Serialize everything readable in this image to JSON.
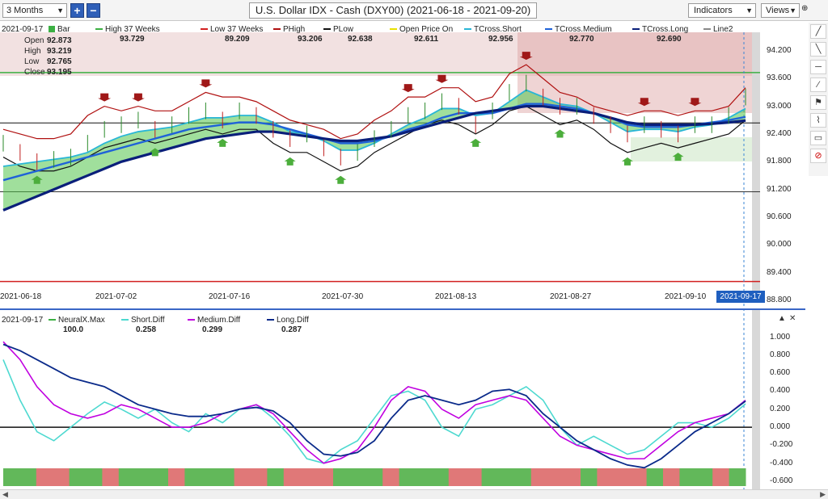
{
  "toolbar": {
    "range_label": "3 Months",
    "zoom_in": "+",
    "zoom_out": "−",
    "title": "U.S. Dollar IDX - Cash (DXY00) (2021-06-18 - 2021-09-20)",
    "indicators_label": "Indicators",
    "views_label": "Views",
    "pin": "⊕"
  },
  "side_tools": [
    "╱",
    "╲",
    "─",
    "⁄",
    "⚑",
    "⌇",
    "▭",
    "⊘"
  ],
  "side_tool_icons": [
    "trendline-icon",
    "ray-icon",
    "horizontal-line-icon",
    "angle-line-icon",
    "flag-icon",
    "fib-icon",
    "rectangle-icon",
    "delete-icon"
  ],
  "price_legend": {
    "date": "2021-09-17",
    "bar_label": "Bar",
    "ohlc": {
      "open_label": "Open",
      "open": "92.873",
      "high_label": "High",
      "high": "93.219",
      "low_label": "Low",
      "low": "92.765",
      "close_label": "Close",
      "close": "93.195"
    },
    "items": [
      {
        "label": "High 37 Weeks",
        "value": "93.729",
        "color": "#3cb043"
      },
      {
        "label": "Low 37 Weeks",
        "value": "89.209",
        "color": "#d22020"
      },
      {
        "label": "PHigh",
        "value": "93.206",
        "color": "#b01010"
      },
      {
        "label": "PLow",
        "value": "92.638",
        "color": "#111111"
      },
      {
        "label": "Open Price On",
        "value": "92.611",
        "color": "#e8e000"
      },
      {
        "label": "TCross.Short",
        "value": "92.956",
        "color": "#29b6d6"
      },
      {
        "label": "TCross.Medium",
        "value": "92.770",
        "color": "#1f62d8"
      },
      {
        "label": "TCross.Long",
        "value": "92.690",
        "color": "#0a1f7a"
      },
      {
        "label": "Line2",
        "value": "",
        "color": "#888888"
      }
    ]
  },
  "indicator_legend": {
    "date": "2021-09-17",
    "items": [
      {
        "label": "NeuralX.Max",
        "value": "100.0",
        "color": "#3cb043"
      },
      {
        "label": "Short.Diff",
        "value": "0.258",
        "color": "#4dd9d0"
      },
      {
        "label": "Medium.Diff",
        "value": "0.299",
        "color": "#c000e0"
      },
      {
        "label": "Long.Diff",
        "value": "0.287",
        "color": "#0a2a8a"
      }
    ]
  },
  "x_labels": [
    "2021-06-18",
    "2021-07-02",
    "2021-07-16",
    "2021-07-30",
    "2021-08-13",
    "2021-08-27",
    "2021-09-10",
    "2021-09-17"
  ],
  "price_ticks": [
    "94.200",
    "93.600",
    "93.000",
    "92.400",
    "91.800",
    "91.200",
    "90.600",
    "90.000",
    "89.400",
    "88.800"
  ],
  "ind_ticks": [
    "1.000",
    "0.800",
    "0.600",
    "0.400",
    "0.200",
    "0.000",
    "-0.200",
    "-0.400",
    "-0.600"
  ],
  "chart_data": [
    {
      "type": "line",
      "title": "U.S. Dollar IDX - Cash (DXY00) (2021-06-18 - 2021-09-20)",
      "ylim": [
        88.8,
        94.6
      ],
      "x_range": [
        "2021-06-18",
        "2021-09-17"
      ],
      "levels": {
        "high_37_weeks": 93.729,
        "low_37_weeks": 89.209,
        "plow_level": 92.638,
        "long_term_low": 91.15
      },
      "series": [
        {
          "name": "Bar",
          "values": [
            92.2,
            92.0,
            91.8,
            91.85,
            91.9,
            92.2,
            92.5,
            92.6,
            92.7,
            92.5,
            92.6,
            92.8,
            92.9,
            92.7,
            92.9,
            92.8,
            92.5,
            92.3,
            92.4,
            92.1,
            91.9,
            92.0,
            92.3,
            92.5,
            92.8,
            92.9,
            93.1,
            93.0,
            92.6,
            92.9,
            93.3,
            93.5,
            93.2,
            93.0,
            93.0,
            92.8,
            92.6,
            92.4,
            92.6,
            92.5,
            92.4,
            92.6,
            92.6,
            92.8,
            93.2
          ]
        },
        {
          "name": "PHigh",
          "values": [
            92.5,
            92.4,
            92.3,
            92.3,
            92.4,
            92.8,
            93.0,
            92.9,
            93.0,
            92.9,
            92.9,
            93.1,
            93.3,
            93.2,
            93.2,
            93.1,
            92.9,
            92.7,
            92.6,
            92.5,
            92.3,
            92.4,
            92.7,
            92.9,
            93.2,
            93.2,
            93.4,
            93.4,
            93.1,
            93.2,
            93.7,
            93.9,
            93.6,
            93.3,
            93.2,
            93.0,
            92.9,
            92.8,
            92.9,
            92.9,
            92.8,
            92.9,
            92.9,
            93.0,
            93.4
          ]
        },
        {
          "name": "PLow",
          "values": [
            91.9,
            91.7,
            91.6,
            91.6,
            91.7,
            91.9,
            92.1,
            92.2,
            92.3,
            92.2,
            92.3,
            92.4,
            92.5,
            92.4,
            92.5,
            92.5,
            92.2,
            92.0,
            92.0,
            91.8,
            91.6,
            91.7,
            92.0,
            92.2,
            92.4,
            92.6,
            92.7,
            92.6,
            92.4,
            92.6,
            92.9,
            93.0,
            92.8,
            92.6,
            92.7,
            92.5,
            92.2,
            92.0,
            92.1,
            92.2,
            92.1,
            92.2,
            92.3,
            92.4,
            92.7
          ]
        },
        {
          "name": "TCross.Short",
          "values": [
            91.7,
            91.75,
            91.8,
            91.85,
            91.9,
            92.0,
            92.2,
            92.35,
            92.45,
            92.5,
            92.55,
            92.65,
            92.75,
            92.75,
            92.8,
            92.8,
            92.65,
            92.45,
            92.4,
            92.25,
            92.05,
            92.05,
            92.2,
            92.4,
            92.6,
            92.75,
            92.95,
            92.95,
            92.8,
            92.85,
            93.1,
            93.35,
            93.2,
            93.05,
            93.0,
            92.85,
            92.65,
            92.45,
            92.5,
            92.5,
            92.45,
            92.55,
            92.6,
            92.75,
            92.95
          ]
        },
        {
          "name": "TCross.Medium",
          "values": [
            91.4,
            91.5,
            91.6,
            91.7,
            91.8,
            91.9,
            92.0,
            92.1,
            92.2,
            92.3,
            92.4,
            92.5,
            92.55,
            92.6,
            92.65,
            92.65,
            92.6,
            92.5,
            92.4,
            92.3,
            92.2,
            92.2,
            92.25,
            92.35,
            92.5,
            92.6,
            92.75,
            92.85,
            92.85,
            92.85,
            92.95,
            93.05,
            93.05,
            93.0,
            92.95,
            92.85,
            92.75,
            92.6,
            92.55,
            92.55,
            92.55,
            92.6,
            92.65,
            92.7,
            92.77
          ]
        },
        {
          "name": "TCross.Long",
          "values": [
            90.75,
            90.9,
            91.05,
            91.2,
            91.35,
            91.5,
            91.65,
            91.8,
            91.9,
            92.0,
            92.1,
            92.2,
            92.3,
            92.35,
            92.4,
            92.45,
            92.45,
            92.4,
            92.35,
            92.3,
            92.25,
            92.25,
            92.3,
            92.35,
            92.45,
            92.55,
            92.65,
            92.75,
            92.85,
            92.9,
            92.95,
            93.0,
            93.0,
            92.95,
            92.9,
            92.85,
            92.75,
            92.65,
            92.6,
            92.6,
            92.6,
            92.6,
            92.62,
            92.65,
            92.69
          ]
        }
      ]
    },
    {
      "type": "line",
      "title": "",
      "ylim": [
        -0.6,
        1.05
      ],
      "x_range": [
        "2021-06-18",
        "2021-09-17"
      ],
      "series": [
        {
          "name": "Short.Diff",
          "values": [
            0.75,
            0.3,
            -0.05,
            -0.15,
            0.0,
            0.15,
            0.28,
            0.2,
            0.1,
            0.2,
            0.05,
            -0.05,
            0.15,
            0.05,
            0.2,
            0.25,
            0.1,
            -0.1,
            -0.35,
            -0.4,
            -0.25,
            -0.15,
            0.1,
            0.35,
            0.4,
            0.3,
            0.0,
            -0.1,
            0.2,
            0.25,
            0.35,
            0.45,
            0.3,
            0.0,
            -0.2,
            -0.1,
            -0.2,
            -0.3,
            -0.25,
            -0.1,
            0.05,
            0.05,
            0.0,
            0.1,
            0.26
          ]
        },
        {
          "name": "Medium.Diff",
          "values": [
            0.95,
            0.75,
            0.45,
            0.25,
            0.15,
            0.1,
            0.15,
            0.25,
            0.2,
            0.1,
            0.0,
            0.0,
            0.05,
            0.15,
            0.2,
            0.25,
            0.15,
            -0.05,
            -0.25,
            -0.4,
            -0.35,
            -0.25,
            0.0,
            0.3,
            0.45,
            0.4,
            0.2,
            0.1,
            0.25,
            0.3,
            0.35,
            0.3,
            0.1,
            -0.1,
            -0.2,
            -0.25,
            -0.3,
            -0.35,
            -0.35,
            -0.2,
            -0.05,
            0.05,
            0.1,
            0.15,
            0.3
          ]
        },
        {
          "name": "Long.Diff",
          "values": [
            0.92,
            0.85,
            0.75,
            0.65,
            0.55,
            0.5,
            0.45,
            0.35,
            0.25,
            0.2,
            0.15,
            0.12,
            0.12,
            0.15,
            0.2,
            0.22,
            0.18,
            0.05,
            -0.15,
            -0.3,
            -0.32,
            -0.28,
            -0.15,
            0.1,
            0.3,
            0.35,
            0.3,
            0.25,
            0.3,
            0.4,
            0.42,
            0.35,
            0.15,
            0.0,
            -0.15,
            -0.25,
            -0.35,
            -0.42,
            -0.45,
            -0.35,
            -0.2,
            -0.05,
            0.05,
            0.15,
            0.29
          ]
        },
        {
          "name": "NeuralX.Max",
          "values": [
            1,
            1,
            0,
            0,
            1,
            1,
            0,
            1,
            1,
            1,
            0,
            1,
            1,
            1,
            0,
            0,
            1,
            0,
            0,
            0,
            1,
            1,
            1,
            0,
            1,
            1,
            1,
            0,
            0,
            1,
            1,
            1,
            0,
            0,
            0,
            1,
            0,
            0,
            0,
            1,
            0,
            1,
            1,
            0,
            1
          ]
        }
      ]
    }
  ]
}
